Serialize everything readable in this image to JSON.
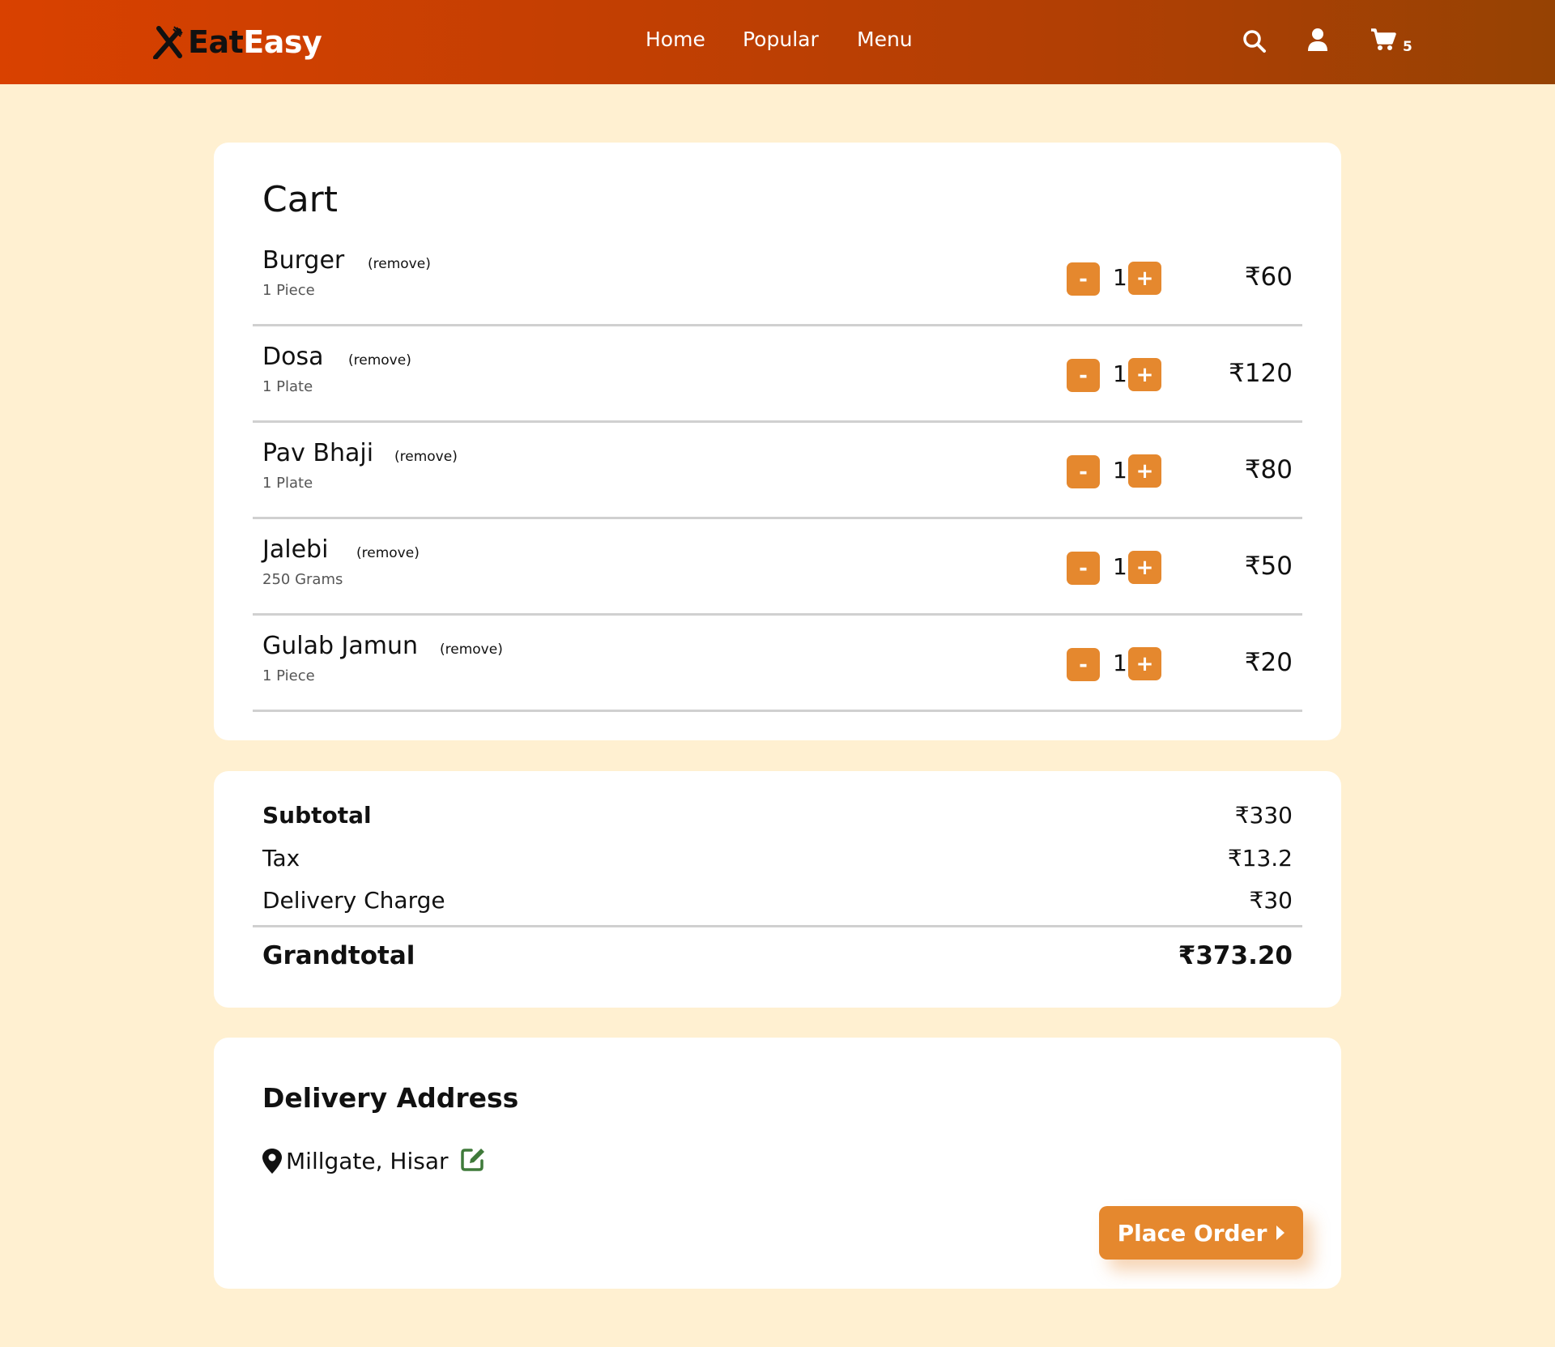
{
  "brand": {
    "part1": "Eat",
    "part2": "Easy"
  },
  "nav": {
    "home": "Home",
    "popular": "Popular",
    "menu": "Menu"
  },
  "header": {
    "cart_count": "5"
  },
  "cart": {
    "title": "Cart",
    "items": [
      {
        "name": "Burger",
        "remove": "(remove)",
        "unit": "1 Piece",
        "qty": "1",
        "price": "₹60"
      },
      {
        "name": "Dosa",
        "remove": "(remove)",
        "unit": "1 Plate",
        "qty": "1",
        "price": "₹120"
      },
      {
        "name": "Pav Bhaji",
        "remove": "(remove)",
        "unit": "1 Plate",
        "qty": "1",
        "price": "₹80"
      },
      {
        "name": "Jalebi",
        "remove": "(remove)",
        "unit": "250 Grams",
        "qty": "1",
        "price": "₹50"
      },
      {
        "name": "Gulab Jamun",
        "remove": "(remove)",
        "unit": "1 Piece",
        "qty": "1",
        "price": "₹20"
      }
    ],
    "minus_label": "-",
    "plus_label": "+"
  },
  "summary": {
    "subtotal_label": "Subtotal",
    "subtotal": "₹330",
    "tax_label": "Tax",
    "tax": "₹13.2",
    "delivery_label": "Delivery Charge",
    "delivery": "₹30",
    "grand_label": "Grandtotal",
    "grand": "₹373.20"
  },
  "address": {
    "title": "Delivery Address",
    "location": "Millgate, Hisar",
    "place_order": "Place Order"
  },
  "colors": {
    "accent": "#e5882e",
    "header_start": "#d94100",
    "header_end": "#964203",
    "background": "#fff0d1",
    "edit_icon": "#3f7a3a"
  }
}
